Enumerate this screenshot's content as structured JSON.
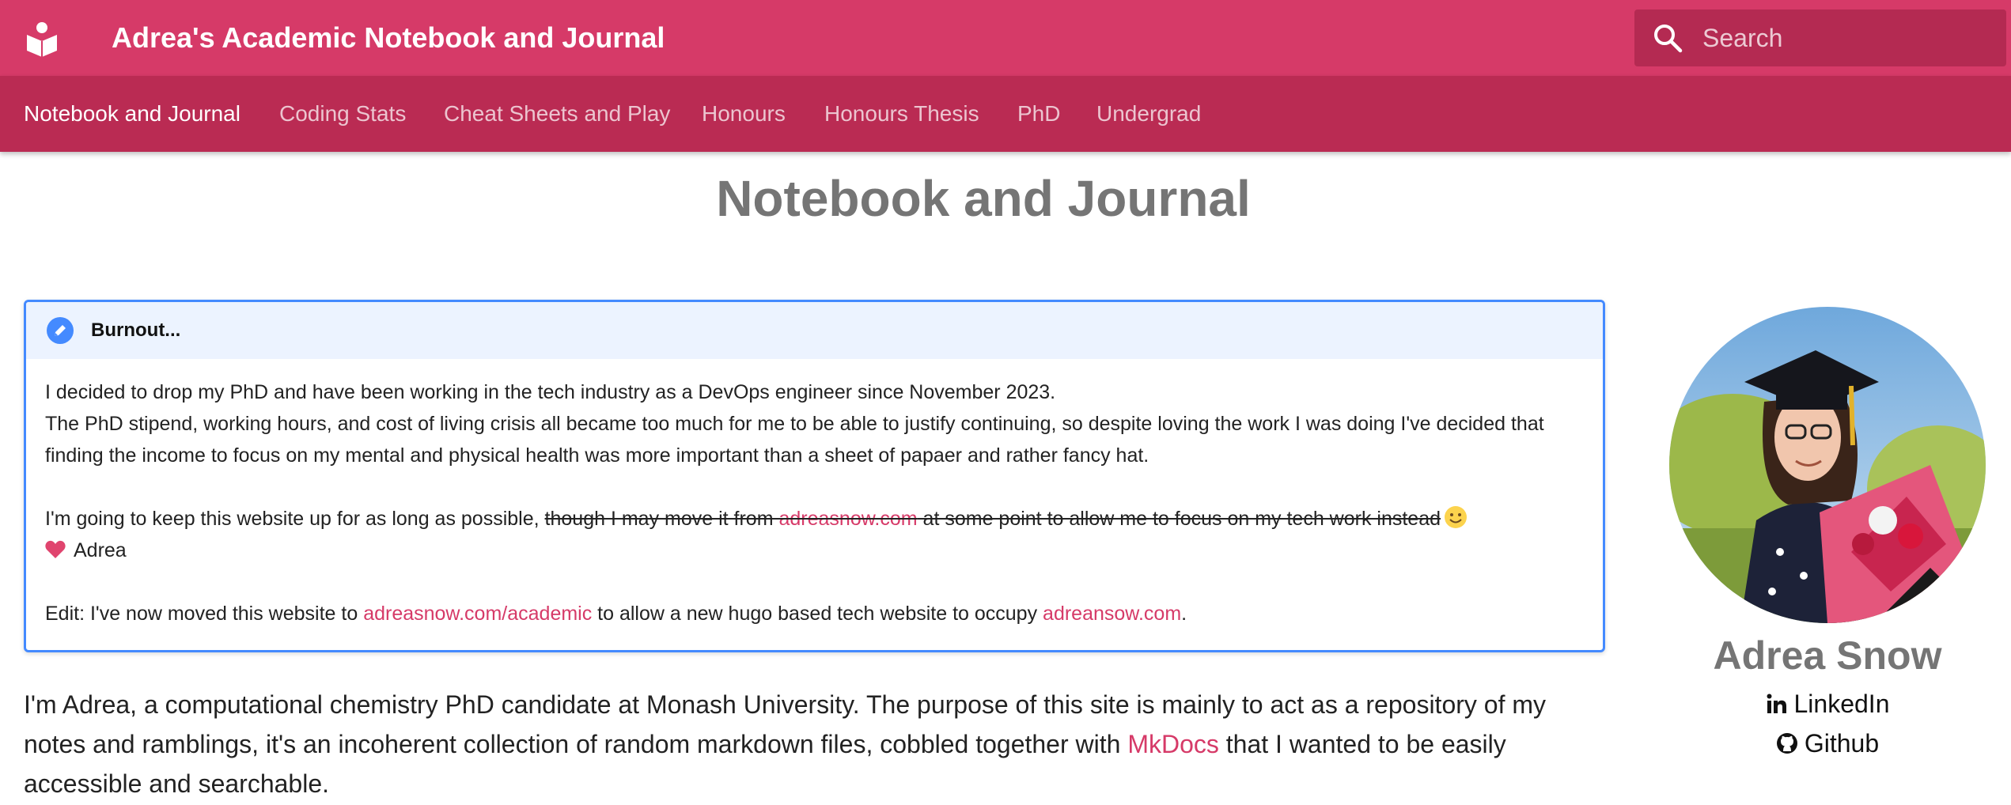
{
  "header": {
    "site_title": "Adrea's Academic Notebook and Journal",
    "logo_icon": "book-reader-icon",
    "search_placeholder": "Search",
    "brand_color": "#d63a68",
    "tabs_color": "#ba2b53"
  },
  "tabs": [
    {
      "label": "Notebook and Journal",
      "active": true
    },
    {
      "label": "Coding Stats",
      "active": false
    },
    {
      "label": "Cheat Sheets and Play",
      "active": false
    },
    {
      "label": "Honours",
      "active": false
    },
    {
      "label": "Honours Thesis",
      "active": false
    },
    {
      "label": "PhD",
      "active": false
    },
    {
      "label": "Undergrad",
      "active": false
    }
  ],
  "page": {
    "title": "Notebook and Journal"
  },
  "admonition": {
    "title": "Burnout...",
    "icon": "pencil-icon",
    "accent_color": "#448aff",
    "line1": "I decided to drop my PhD and have been working in the tech industry as a DevOps engineer since November 2023.",
    "line2": "The PhD stipend, working hours, and cost of living crisis all became too much for me to be able to justify continuing, so despite loving the work I was doing I've decided that finding the income to focus on my mental and physical health was more important than a sheet of papaer and rather fancy hat.",
    "keep_prefix": "I'm going to keep this website up for as long as possible, ",
    "strike_before": "though I may move it from ",
    "strike_link": "adreasnow.com",
    "strike_after": " at some point to allow me to focus on my tech work instead",
    "signature": "Adrea",
    "edit_prefix": "Edit: I've now moved this website to ",
    "edit_link1": "adreasnow.com/academic",
    "edit_middle": " to allow a new hugo based tech website to occupy ",
    "edit_link2": "adreansow.com",
    "edit_suffix": "."
  },
  "intro": {
    "before": "I'm Adrea, a computational chemistry PhD candidate at Monash University. The purpose of this site is mainly to act as a repository of my notes and ramblings, it's an incoherent collection of random markdown files, cobbled together with ",
    "link": "MkDocs",
    "after": " that I wanted to be easily accessible and searchable."
  },
  "profile": {
    "name": "Adrea Snow",
    "linkedin_label": "LinkedIn",
    "github_label": "Github"
  }
}
